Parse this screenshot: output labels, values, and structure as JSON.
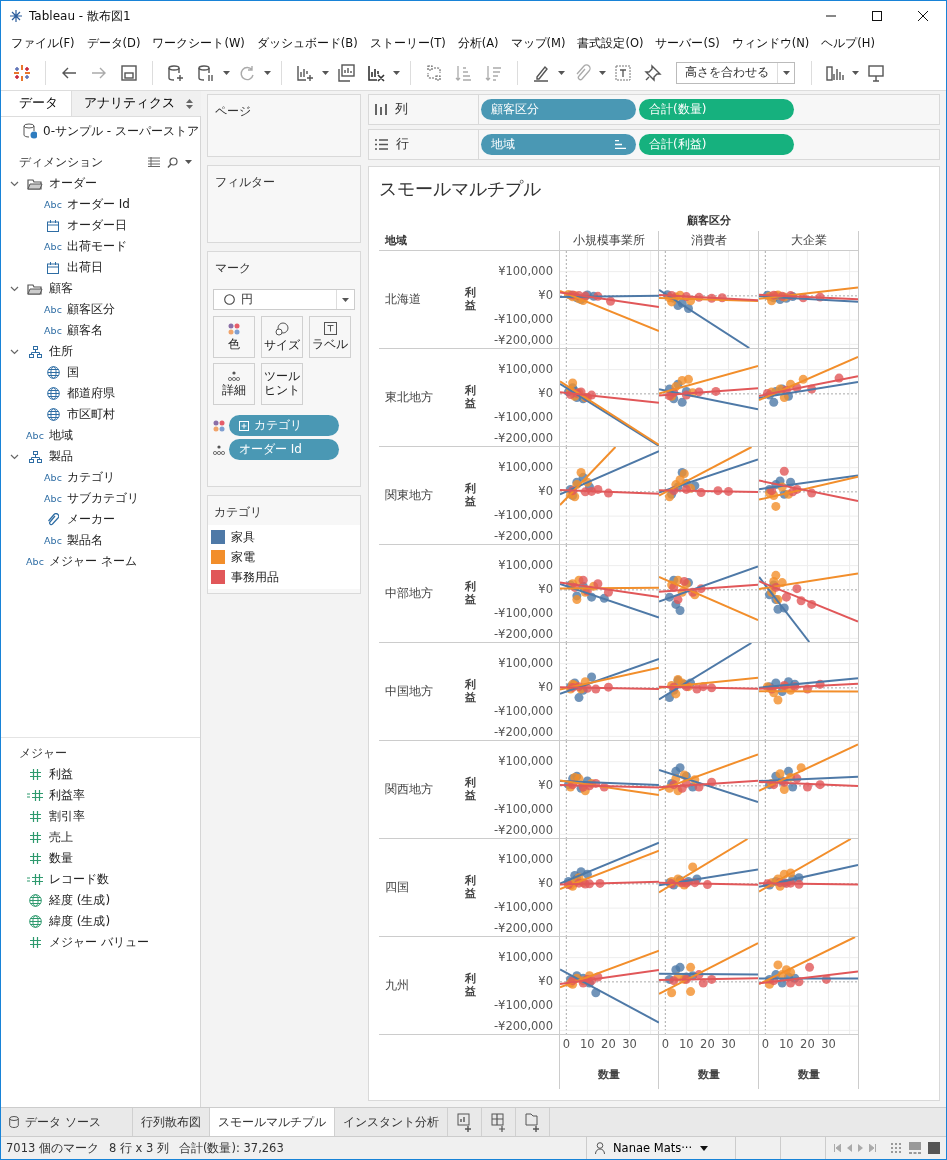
{
  "window": {
    "title": "Tableau - 散布図1"
  },
  "menu": [
    "ファイル(F)",
    "データ(D)",
    "ワークシート(W)",
    "ダッシュボード(B)",
    "ストーリー(T)",
    "分析(A)",
    "マップ(M)",
    "書式設定(O)",
    "サーバー(S)",
    "ウィンドウ(N)",
    "ヘルプ(H)"
  ],
  "toolbar": {
    "fit": "高さを合わせる"
  },
  "data_pane": {
    "tabs": [
      {
        "label": "データ",
        "selected": true
      },
      {
        "label": "アナリティクス",
        "selected": false
      }
    ],
    "data_source": "0-サンプル - スーパーストア",
    "dimensions": {
      "title": "ディメンション",
      "items": [
        {
          "label": "オーダー",
          "kind": "folder",
          "expanded": true,
          "children": [
            {
              "label": "オーダー Id",
              "kind": "string",
              "type_text": "Abc"
            },
            {
              "label": "オーダー日",
              "kind": "date"
            },
            {
              "label": "出荷モード",
              "kind": "string",
              "type_text": "Abc"
            },
            {
              "label": "出荷日",
              "kind": "date"
            }
          ]
        },
        {
          "label": "顧客",
          "kind": "folder",
          "expanded": true,
          "children": [
            {
              "label": "顧客区分",
              "kind": "string",
              "type_text": "Abc"
            },
            {
              "label": "顧客名",
              "kind": "string",
              "type_text": "Abc"
            }
          ]
        },
        {
          "label": "住所",
          "kind": "hierarchy",
          "expanded": true,
          "children": [
            {
              "label": "国",
              "kind": "geo"
            },
            {
              "label": "都道府県",
              "kind": "geo"
            },
            {
              "label": "市区町村",
              "kind": "geo"
            }
          ]
        },
        {
          "label": "地域",
          "kind": "string",
          "type_text": "Abc"
        },
        {
          "label": "製品",
          "kind": "hierarchy",
          "expanded": true,
          "children": [
            {
              "label": "カテゴリ",
              "kind": "string",
              "type_text": "Abc"
            },
            {
              "label": "サブカテゴリ",
              "kind": "string",
              "type_text": "Abc"
            },
            {
              "label": "メーカー",
              "kind": "group"
            },
            {
              "label": "製品名",
              "kind": "string",
              "type_text": "Abc"
            }
          ]
        },
        {
          "label": "メジャー ネーム",
          "kind": "string",
          "type_text": "Abc"
        }
      ]
    },
    "measures": {
      "title": "メジャー",
      "items": [
        {
          "label": "利益",
          "kind": "number"
        },
        {
          "label": "利益率",
          "kind": "calc"
        },
        {
          "label": "割引率",
          "kind": "number"
        },
        {
          "label": "売上",
          "kind": "number"
        },
        {
          "label": "数量",
          "kind": "number"
        },
        {
          "label": "レコード数",
          "kind": "calc"
        },
        {
          "label": "経度 (生成)",
          "kind": "geo"
        },
        {
          "label": "緯度 (生成)",
          "kind": "geo"
        },
        {
          "label": "メジャー バリュー",
          "kind": "number"
        }
      ]
    }
  },
  "cards": {
    "pages": {
      "title": "ページ"
    },
    "filters": {
      "title": "フィルター"
    },
    "marks": {
      "title": "マーク",
      "mark_type": "円",
      "buttons": [
        {
          "label": "色",
          "kind": "color"
        },
        {
          "label": "サイズ",
          "kind": "size"
        },
        {
          "label": "ラベル",
          "kind": "label"
        },
        {
          "label": "詳細",
          "kind": "detail"
        },
        {
          "label": "ツールヒント",
          "kind": "tooltip"
        }
      ],
      "pills": [
        {
          "label": "カテゴリ",
          "kind": "color"
        },
        {
          "label": "オーダー Id",
          "kind": "detail"
        }
      ]
    },
    "legend": {
      "title": "カテゴリ",
      "items": [
        {
          "label": "家具",
          "color": "#4e79a7"
        },
        {
          "label": "家電",
          "color": "#f28e2b"
        },
        {
          "label": "事務用品",
          "color": "#e15759"
        }
      ]
    }
  },
  "shelves": {
    "columns": {
      "label": "列",
      "pills": [
        {
          "label": "顧客区分",
          "kind": "dimension",
          "sorted": false
        },
        {
          "label": "合計(数量)",
          "kind": "measure",
          "sorted": false
        }
      ]
    },
    "rows": {
      "label": "行",
      "pills": [
        {
          "label": "地域",
          "kind": "dimension",
          "sorted": true
        },
        {
          "label": "合計(利益)",
          "kind": "measure",
          "sorted": false
        }
      ]
    }
  },
  "view": {
    "title": "スモールマルチプル",
    "column_field": "顧客区分",
    "row_field": "地域",
    "columns": [
      {
        "label": "小規模事業所",
        "x_title": "数量",
        "xticks": [
          "0",
          "10",
          "20",
          "30"
        ]
      },
      {
        "label": "消費者",
        "x_title": "数量",
        "xticks": [
          "0",
          "10",
          "20",
          "30"
        ]
      },
      {
        "label": "大企業",
        "x_title": "数量",
        "xticks": [
          "0",
          "10",
          "20",
          "30"
        ]
      }
    ],
    "rows": [
      {
        "label": "北海道",
        "y_title": "利益",
        "yticks": [
          "¥100,000",
          "¥0",
          "-¥100,000",
          "-¥200,000"
        ]
      },
      {
        "label": "東北地方",
        "y_title": "利益",
        "yticks": [
          "¥100,000",
          "¥0",
          "-¥100,000",
          "-¥200,000"
        ]
      },
      {
        "label": "関東地方",
        "y_title": "利益",
        "yticks": [
          "¥100,000",
          "¥0",
          "-¥100,000",
          "-¥200,000"
        ]
      },
      {
        "label": "中部地方",
        "y_title": "利益",
        "yticks": [
          "¥100,000",
          "¥0",
          "-¥100,000",
          "-¥200,000"
        ]
      },
      {
        "label": "中国地方",
        "y_title": "利益",
        "yticks": [
          "¥100,000",
          "¥0",
          "-¥100,000",
          "-¥200,000"
        ]
      },
      {
        "label": "関西地方",
        "y_title": "利益",
        "yticks": [
          "¥100,000",
          "¥0",
          "-¥100,000",
          "-¥200,000"
        ]
      },
      {
        "label": "四国",
        "y_title": "利益",
        "yticks": [
          "¥100,000",
          "¥0",
          "-¥100,000",
          "-¥200,000"
        ]
      },
      {
        "label": "九州",
        "y_title": "利益",
        "yticks": [
          "¥100,000",
          "¥0",
          "-¥100,000",
          "-¥200,000"
        ]
      }
    ]
  },
  "sheet_tabs": [
    {
      "label": "データ ソース",
      "kind": "datasource",
      "selected": false
    },
    {
      "label": "行列散布図",
      "kind": "sheet",
      "selected": false
    },
    {
      "label": "スモールマルチプル",
      "kind": "sheet",
      "selected": true
    },
    {
      "label": "インスタント分析",
      "kind": "sheet",
      "selected": false
    }
  ],
  "status_bar": {
    "marks": "7013 個のマーク",
    "grid": "8 行 x 3 列",
    "sum": "合計(数量): 37,263",
    "user": "Nanae Mats···"
  }
}
